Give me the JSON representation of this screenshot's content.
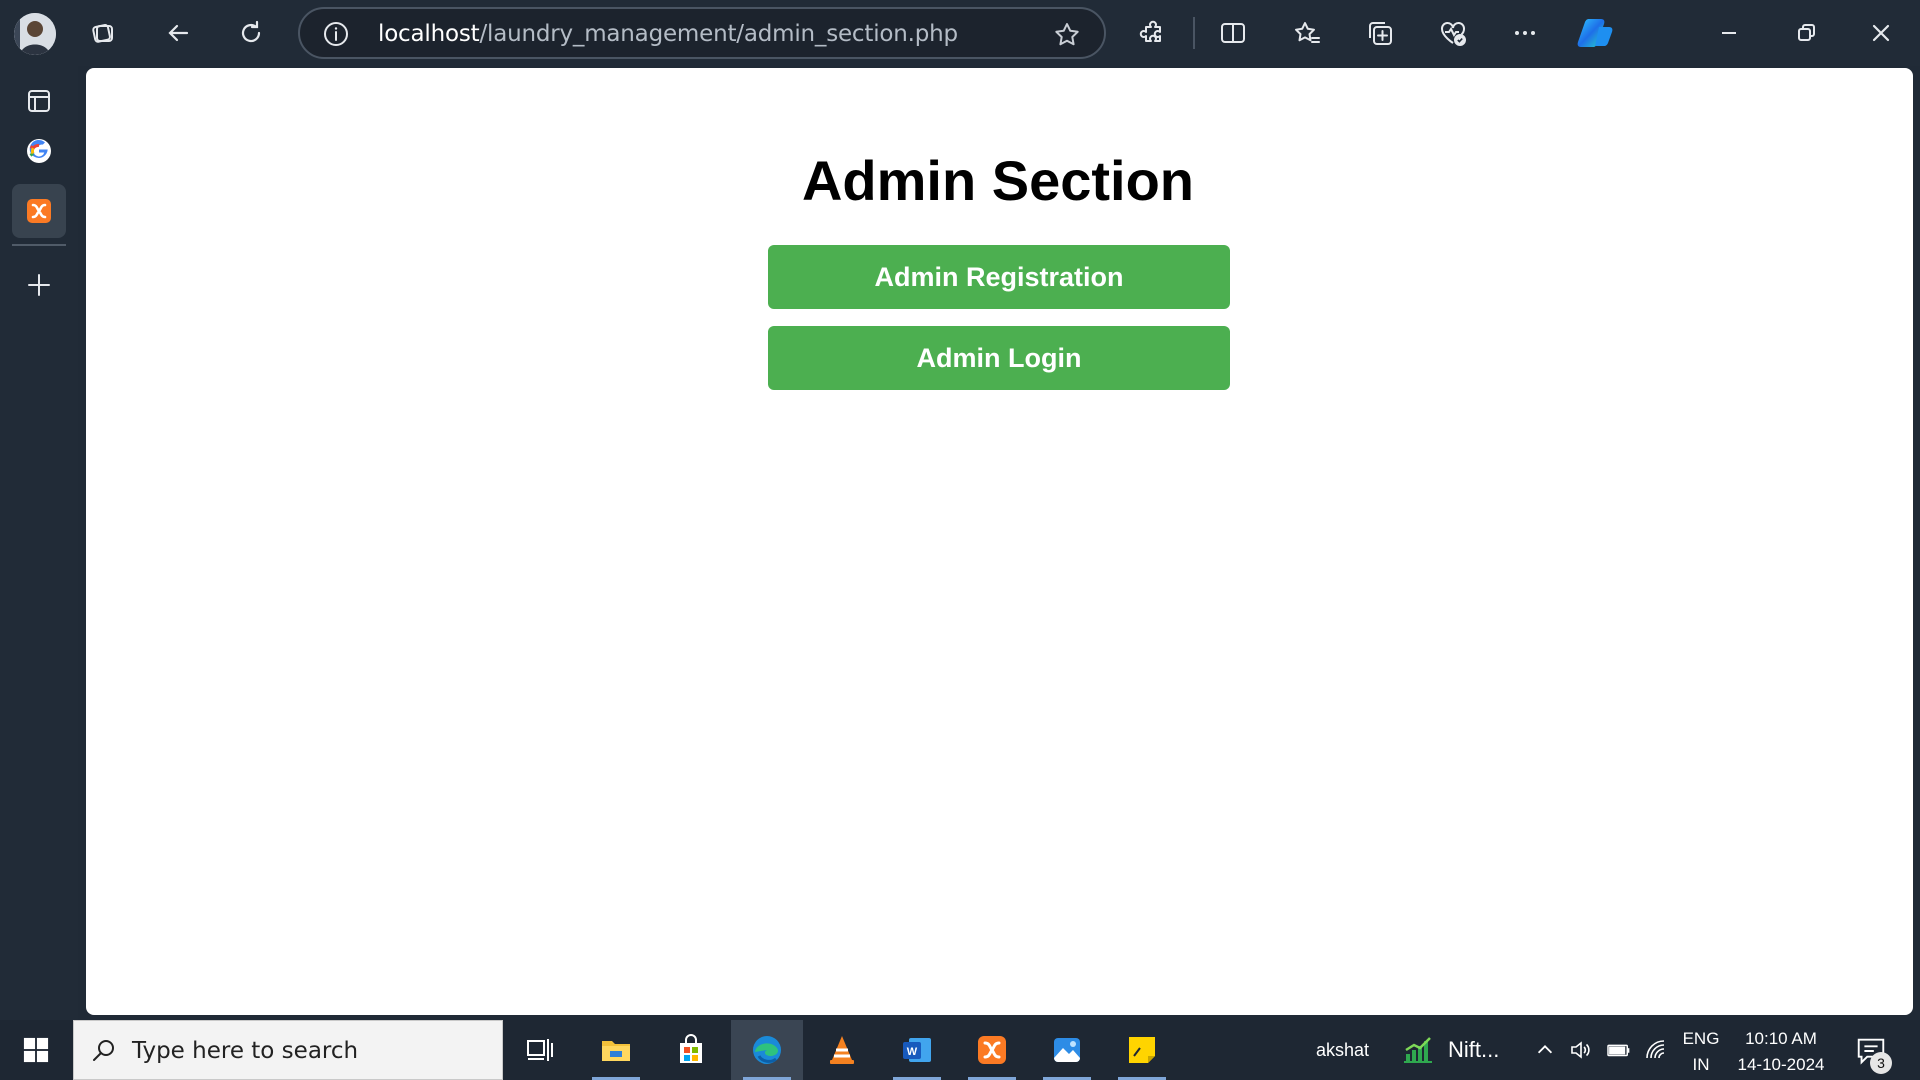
{
  "browser": {
    "url_host": "localhost",
    "url_path": "/laundry_management/admin_section.php"
  },
  "page": {
    "title": "Admin Section",
    "buttons": {
      "registration": "Admin Registration",
      "login": "Admin Login"
    },
    "button_color": "#4caf50"
  },
  "taskbar": {
    "search_placeholder": "Type here to search",
    "user_label": "akshat",
    "stock_label": "Nift...",
    "lang_line1": "ENG",
    "lang_line2": "IN",
    "time": "10:10 AM",
    "date": "14-10-2024",
    "notification_count": "3"
  },
  "icons": {
    "top": [
      "profile-avatar",
      "tabs-icon",
      "back-arrow-icon",
      "refresh-icon",
      "info-icon",
      "favorite-star-icon",
      "extensions-icon",
      "split-screen-icon",
      "favorites-icon",
      "collections-icon",
      "browser-essentials-icon",
      "more-menu-icon",
      "copilot-icon",
      "minimize-icon",
      "restore-icon",
      "close-icon"
    ],
    "rail": [
      "vertical-tabs-icon",
      "google-tab-icon",
      "xampp-tab-icon",
      "new-tab-plus-icon"
    ],
    "taskbar": [
      "windows-start-icon",
      "search-icon",
      "task-view-icon",
      "file-explorer-icon",
      "microsoft-store-icon",
      "edge-icon",
      "vlc-icon",
      "word-icon",
      "xampp-icon",
      "photos-icon",
      "sticky-notes-icon",
      "stock-chart-icon",
      "chevron-up-icon",
      "volume-icon",
      "battery-icon",
      "wifi-icon",
      "notification-icon"
    ]
  }
}
